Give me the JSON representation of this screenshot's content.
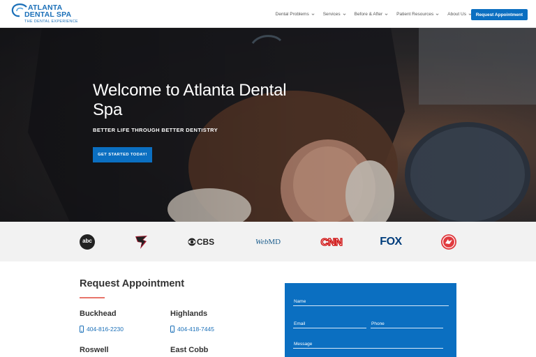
{
  "header": {
    "logo": {
      "line1": "ATLANTA",
      "line2": "DENTAL SPA",
      "tagline": "THE DENTAL EXPERIENCE"
    },
    "nav": [
      {
        "label": "Dental Problems"
      },
      {
        "label": "Services"
      },
      {
        "label": "Before & After"
      },
      {
        "label": "Patient Resources"
      },
      {
        "label": "About Us"
      }
    ],
    "cta_label": "Request Appointment"
  },
  "hero": {
    "title": "Welcome to Atlanta Dental Spa",
    "subtitle": "BETTER LIFE THROUGH BETTER DENTISTRY",
    "cta_label": "GET STARTED TODAY!"
  },
  "press": {
    "logos": [
      {
        "icon": "abc-logo",
        "text": "abc"
      },
      {
        "icon": "falcons-logo",
        "text": ""
      },
      {
        "icon": "cbs-logo",
        "text": "CBS"
      },
      {
        "icon": "webmd-logo",
        "text_a": "Web",
        "text_b": "MD"
      },
      {
        "icon": "cnn-logo",
        "text": "CNN"
      },
      {
        "icon": "fox-logo",
        "text": "FOX"
      },
      {
        "icon": "hawks-logo",
        "text": ""
      }
    ]
  },
  "appointment": {
    "title": "Request Appointment",
    "locations": [
      {
        "name": "Buckhead",
        "phone": "404-816-2230"
      },
      {
        "name": "Highlands",
        "phone": "404-418-7445"
      },
      {
        "name": "Roswell",
        "phone": ""
      },
      {
        "name": "East Cobb",
        "phone": ""
      }
    ],
    "form": {
      "name_label": "Name",
      "email_label": "Email",
      "phone_label": "Phone",
      "message_label": "Message"
    }
  },
  "colors": {
    "brand_blue": "#0b6fc1",
    "accent_rule": "#e8746a",
    "press_bg": "#f2f2f2"
  }
}
